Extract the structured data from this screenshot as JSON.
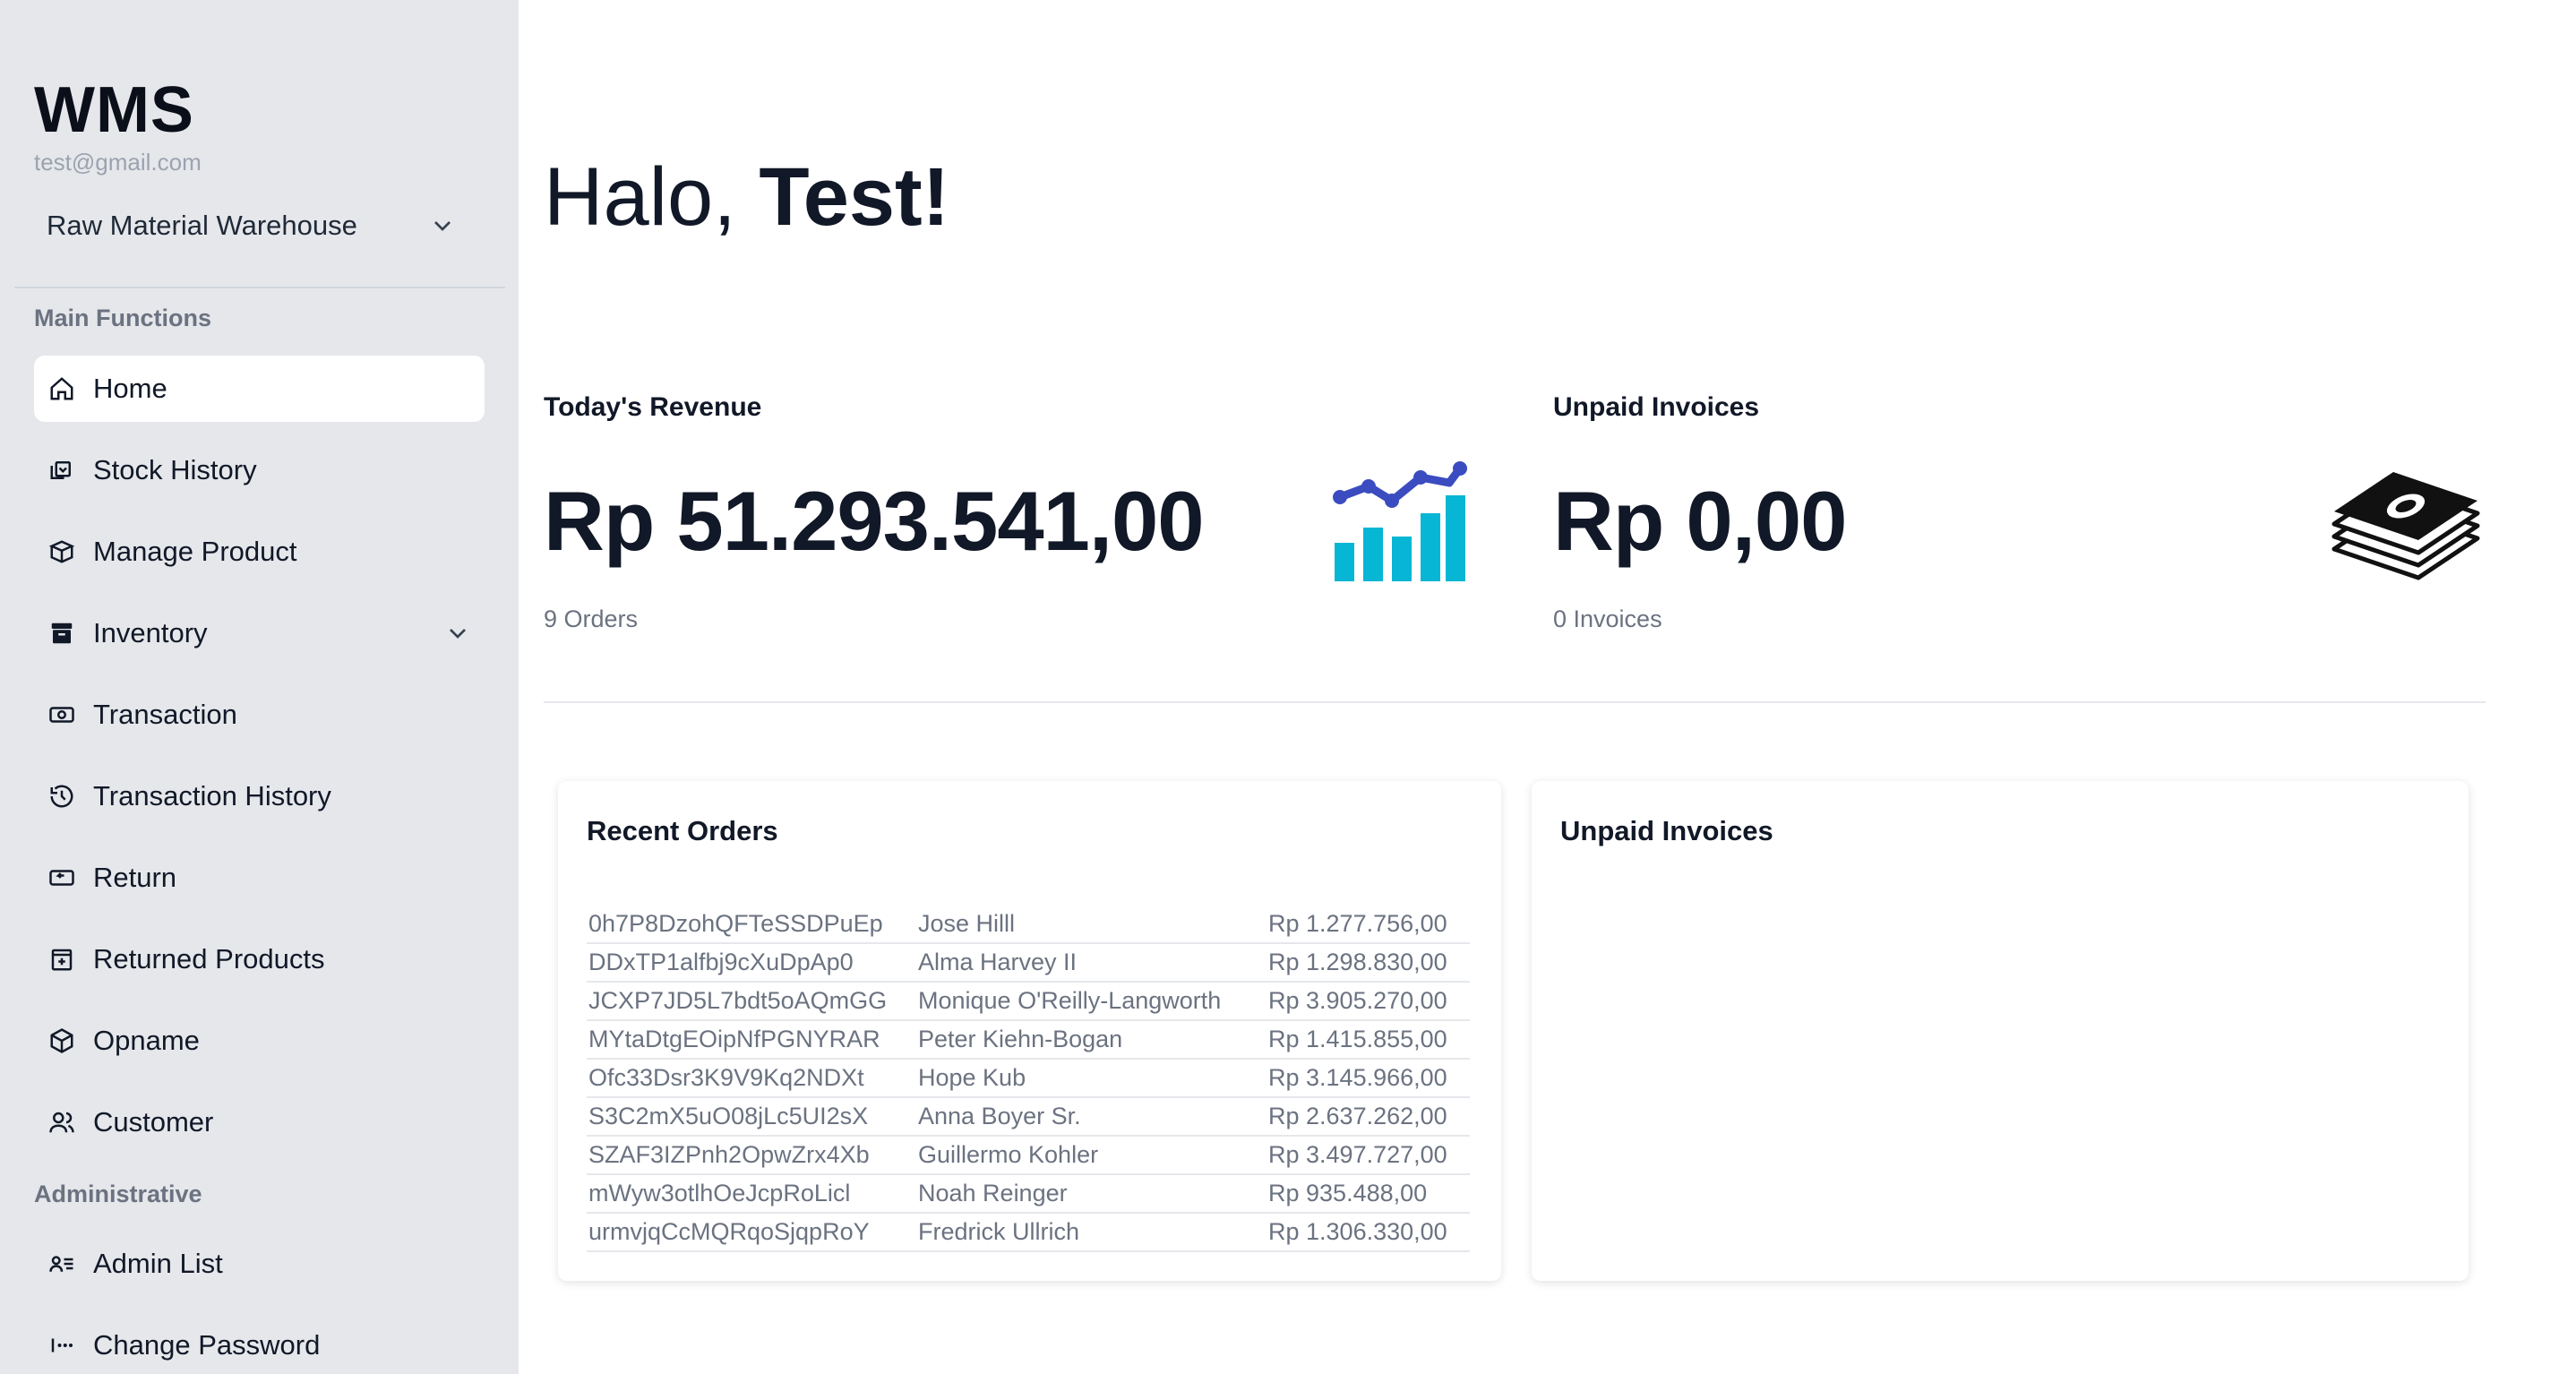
{
  "sidebar": {
    "brand": "WMS",
    "email": "test@gmail.com",
    "warehouse": "Raw Material Warehouse",
    "sections": {
      "main": "Main Functions",
      "admin": "Administrative"
    },
    "items": [
      {
        "label": "Home",
        "icon": "home-icon"
      },
      {
        "label": "Stock History",
        "icon": "stock-history-icon"
      },
      {
        "label": "Manage Product",
        "icon": "box-icon"
      },
      {
        "label": "Inventory",
        "icon": "archive-icon"
      },
      {
        "label": "Transaction",
        "icon": "cash-icon"
      },
      {
        "label": "Transaction History",
        "icon": "history-icon"
      },
      {
        "label": "Return",
        "icon": "return-icon"
      },
      {
        "label": "Returned Products",
        "icon": "returned-box-icon"
      },
      {
        "label": "Opname",
        "icon": "cube-icon"
      },
      {
        "label": "Customer",
        "icon": "users-icon"
      }
    ],
    "admin_items": [
      {
        "label": "Admin List",
        "icon": "user-list-icon"
      },
      {
        "label": "Change Password",
        "icon": "password-icon"
      }
    ]
  },
  "main": {
    "greeting_prefix": "Halo, ",
    "greeting_name": "Test!",
    "revenue": {
      "title": "Today's Revenue",
      "value": "Rp 51.293.541,00",
      "sub": "9 Orders"
    },
    "unpaid": {
      "title": "Unpaid Invoices",
      "value": "Rp 0,00",
      "sub": "0 Invoices"
    },
    "recent_orders": {
      "title": "Recent Orders",
      "rows": [
        {
          "id": "0h7P8DzohQFTeSSDPuEp",
          "customer": "Jose Hilll",
          "amount": "Rp 1.277.756,00"
        },
        {
          "id": "DDxTP1alfbj9cXuDpAp0",
          "customer": "Alma Harvey II",
          "amount": "Rp 1.298.830,00"
        },
        {
          "id": "JCXP7JD5L7bdt5oAQmGG",
          "customer": "Monique O'Reilly-Langworth",
          "amount": "Rp 3.905.270,00"
        },
        {
          "id": "MYtaDtgEOipNfPGNYRAR",
          "customer": "Peter Kiehn-Bogan",
          "amount": "Rp 1.415.855,00"
        },
        {
          "id": "Ofc33Dsr3K9V9Kq2NDXt",
          "customer": "Hope Kub",
          "amount": "Rp 3.145.966,00"
        },
        {
          "id": "S3C2mX5uO08jLc5UI2sX",
          "customer": "Anna Boyer Sr.",
          "amount": "Rp 2.637.262,00"
        },
        {
          "id": "SZAF3IZPnh2OpwZrx4Xb",
          "customer": "Guillermo Kohler",
          "amount": "Rp 3.497.727,00"
        },
        {
          "id": "mWyw3otlhOeJcpRoLicl",
          "customer": "Noah Reinger",
          "amount": "Rp 935.488,00"
        },
        {
          "id": "urmvjqCcMQRqoSjqpRoY",
          "customer": "Fredrick Ullrich",
          "amount": "Rp 1.306.330,00"
        }
      ]
    },
    "unpaid_card": {
      "title": "Unpaid Invoices"
    }
  },
  "colors": {
    "sidebar_bg": "#e5e7eb",
    "chart_bar": "#06b6d4",
    "chart_line": "#3b4cc0"
  }
}
